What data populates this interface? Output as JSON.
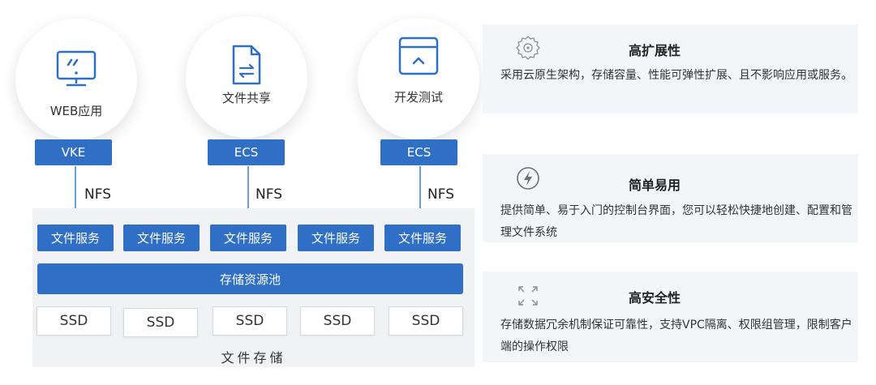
{
  "apps": [
    {
      "label": "WEB应用",
      "icon": "monitor-icon",
      "platform": "VKE"
    },
    {
      "label": "文件共享",
      "icon": "file-share-icon",
      "platform": "ECS"
    },
    {
      "label": "开发测试",
      "icon": "window-chevron-icon",
      "platform": "ECS"
    }
  ],
  "protocol_label": "NFS",
  "file_services": [
    "文件服务",
    "文件服务",
    "文件服务",
    "文件服务",
    "文件服务"
  ],
  "storage_pool": "存储资源池",
  "ssds": [
    "SSD",
    "SSD",
    "SSD",
    "SSD",
    "SSD"
  ],
  "storage_title": "文件存储",
  "features": [
    {
      "title": "高扩展性",
      "icon": "gear-network-icon",
      "desc": "采用云原生架构，存储容量、性能可弹性扩展、且不影响应用或服务。"
    },
    {
      "title": "简单易用",
      "icon": "lightning-icon",
      "desc": "提供简单、易于入门的控制台界面，您可以轻松快捷地创建、配置和管理文件系统"
    },
    {
      "title": "高安全性",
      "icon": "expand-arrows-icon",
      "desc": "存储数据冗余机制保证可靠性，支持VPC隔离、权限组管理，限制客户端的操作权限"
    }
  ],
  "colors": {
    "primary": "#2f6fc6",
    "arrow": "#6aa0de",
    "panel": "#f1f2f4",
    "feature_bg": "#f3f5f8"
  }
}
